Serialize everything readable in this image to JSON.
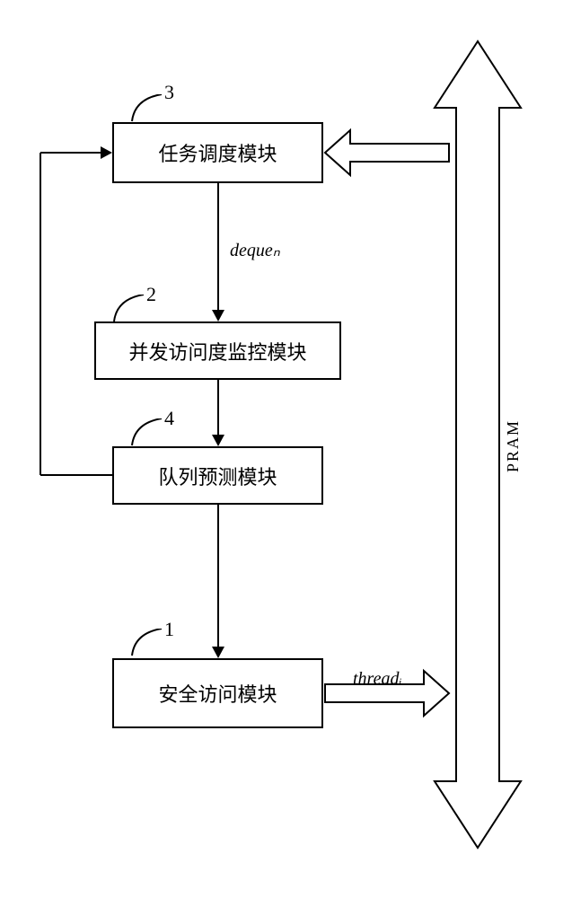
{
  "boxes": {
    "box3": {
      "label": "任务调度模块",
      "num": "3"
    },
    "box2": {
      "label": "并发访问度监控模块",
      "num": "2"
    },
    "box4": {
      "label": "队列预测模块",
      "num": "4"
    },
    "box1": {
      "label": "安全访问模块",
      "num": "1"
    }
  },
  "arrows": {
    "deque": "dequeₙ",
    "thread": "threadᵢ"
  },
  "sidebar": {
    "pram": "PRAM"
  }
}
